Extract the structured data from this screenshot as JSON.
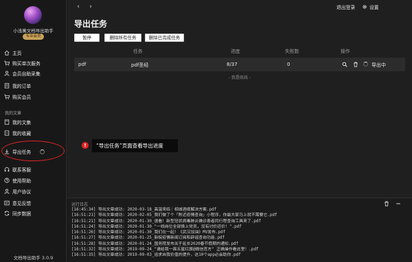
{
  "app": {
    "title": "小浅萬文档导出助手",
    "member_badge": "专业会员",
    "version": "文档导出助手 3.0.9"
  },
  "sidebar": {
    "primary": [
      {
        "label": "主页",
        "icon": "home-icon"
      },
      {
        "label": "购买单次服务",
        "icon": "cart-icon"
      },
      {
        "label": "会员自助采集",
        "icon": "user-icon"
      },
      {
        "label": "我的订单",
        "icon": "order-icon"
      },
      {
        "label": "购买会员",
        "icon": "cart-icon"
      }
    ],
    "section_title": "我的文章",
    "mine": [
      {
        "label": "我的文集",
        "icon": "folder-icon"
      },
      {
        "label": "我的收藏",
        "icon": "star-icon"
      }
    ],
    "export": {
      "label": "导出任务",
      "icon": "download-icon"
    },
    "support": [
      {
        "label": "联系客服",
        "icon": "headset-icon"
      },
      {
        "label": "使用帮助",
        "icon": "help-icon"
      },
      {
        "label": "用户协议",
        "icon": "user-icon"
      },
      {
        "label": "意见反馈",
        "icon": "feedback-icon"
      },
      {
        "label": "同步数据",
        "icon": "sync-icon"
      }
    ]
  },
  "topbar": {
    "back": "‹",
    "forward": "›",
    "logout": "退出登录",
    "settings": "设置"
  },
  "main": {
    "title": "导出任务",
    "buttons": {
      "pause": "暂停",
      "delete_all": "删除所有任务",
      "delete_done": "删除已完成任务"
    },
    "columns": {
      "task": "任务",
      "progress": "进度",
      "failed": "失败数",
      "action": "操作"
    },
    "rows": [
      {
        "type": "pdf",
        "name": "pdf圣经",
        "progress": "8/37",
        "failed": "0",
        "status": "导出中"
      }
    ],
    "end_text": "- 我是底线 -"
  },
  "callout": {
    "number": "!",
    "text": "“导出任务”页面查看导出进度"
  },
  "log": {
    "title": "运行日志",
    "lines": [
      "[16:45:34] 导出文章成功: 2020-03-18_高温来临｜相城酒缆解决方案.pdf",
      "[16:51:21] 导出文章成功: 2020-02-05_我们做了个「附近疫情查询」小程序，你最大家马上就不需要它.pdf",
      "[16:51:21] 导出文章成功: 2020-01-30_速看！新型冠状病毒肺炎确诊患者同行程查询工具来了.pdf",
      "[16:51:24] 导出文章成功: 2020-01-30_\"一线岗位全部换上党员，没有讨价还价！\".pdf",
      "[16:51:26] 导出文章成功: 2020-01-30_我们在一起！《武汉加油》MV发布.pdf",
      "[16:51:27] 导出文章成功: 2020-01-25_新皖疫情新闻订阅和辟谣查询功能.pdf",
      "[16:51:28] 导出文章成功: 2020-01-24_国务院发布关于延长2020春节假期的通知.pdf",
      "[16:51:32] 导出文章成功: 2019-09-24_\"请给我一面五星红旗@微信官方\" 正确操作看这里！.pdf",
      "[16:51:35] 导出文章成功: 2019-09-03_追求自我价值的提升，这10个app必会助你.pdf"
    ]
  },
  "colors": {
    "accent_red": "#e02424",
    "badge_gold": "#c9a25a",
    "background": "#1f1f1f"
  }
}
